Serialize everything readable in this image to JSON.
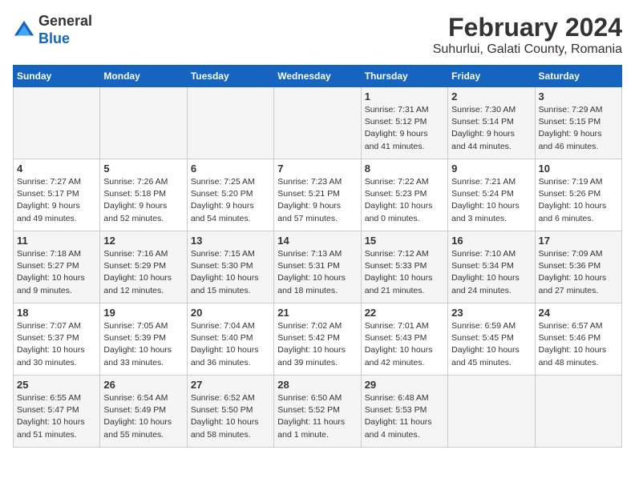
{
  "header": {
    "logo_line1": "General",
    "logo_line2": "Blue",
    "title": "February 2024",
    "subtitle": "Suhurlui, Galati County, Romania"
  },
  "columns": [
    "Sunday",
    "Monday",
    "Tuesday",
    "Wednesday",
    "Thursday",
    "Friday",
    "Saturday"
  ],
  "weeks": [
    [
      {
        "day": "",
        "info": ""
      },
      {
        "day": "",
        "info": ""
      },
      {
        "day": "",
        "info": ""
      },
      {
        "day": "",
        "info": ""
      },
      {
        "day": "1",
        "info": "Sunrise: 7:31 AM\nSunset: 5:12 PM\nDaylight: 9 hours\nand 41 minutes."
      },
      {
        "day": "2",
        "info": "Sunrise: 7:30 AM\nSunset: 5:14 PM\nDaylight: 9 hours\nand 44 minutes."
      },
      {
        "day": "3",
        "info": "Sunrise: 7:29 AM\nSunset: 5:15 PM\nDaylight: 9 hours\nand 46 minutes."
      }
    ],
    [
      {
        "day": "4",
        "info": "Sunrise: 7:27 AM\nSunset: 5:17 PM\nDaylight: 9 hours\nand 49 minutes."
      },
      {
        "day": "5",
        "info": "Sunrise: 7:26 AM\nSunset: 5:18 PM\nDaylight: 9 hours\nand 52 minutes."
      },
      {
        "day": "6",
        "info": "Sunrise: 7:25 AM\nSunset: 5:20 PM\nDaylight: 9 hours\nand 54 minutes."
      },
      {
        "day": "7",
        "info": "Sunrise: 7:23 AM\nSunset: 5:21 PM\nDaylight: 9 hours\nand 57 minutes."
      },
      {
        "day": "8",
        "info": "Sunrise: 7:22 AM\nSunset: 5:23 PM\nDaylight: 10 hours\nand 0 minutes."
      },
      {
        "day": "9",
        "info": "Sunrise: 7:21 AM\nSunset: 5:24 PM\nDaylight: 10 hours\nand 3 minutes."
      },
      {
        "day": "10",
        "info": "Sunrise: 7:19 AM\nSunset: 5:26 PM\nDaylight: 10 hours\nand 6 minutes."
      }
    ],
    [
      {
        "day": "11",
        "info": "Sunrise: 7:18 AM\nSunset: 5:27 PM\nDaylight: 10 hours\nand 9 minutes."
      },
      {
        "day": "12",
        "info": "Sunrise: 7:16 AM\nSunset: 5:29 PM\nDaylight: 10 hours\nand 12 minutes."
      },
      {
        "day": "13",
        "info": "Sunrise: 7:15 AM\nSunset: 5:30 PM\nDaylight: 10 hours\nand 15 minutes."
      },
      {
        "day": "14",
        "info": "Sunrise: 7:13 AM\nSunset: 5:31 PM\nDaylight: 10 hours\nand 18 minutes."
      },
      {
        "day": "15",
        "info": "Sunrise: 7:12 AM\nSunset: 5:33 PM\nDaylight: 10 hours\nand 21 minutes."
      },
      {
        "day": "16",
        "info": "Sunrise: 7:10 AM\nSunset: 5:34 PM\nDaylight: 10 hours\nand 24 minutes."
      },
      {
        "day": "17",
        "info": "Sunrise: 7:09 AM\nSunset: 5:36 PM\nDaylight: 10 hours\nand 27 minutes."
      }
    ],
    [
      {
        "day": "18",
        "info": "Sunrise: 7:07 AM\nSunset: 5:37 PM\nDaylight: 10 hours\nand 30 minutes."
      },
      {
        "day": "19",
        "info": "Sunrise: 7:05 AM\nSunset: 5:39 PM\nDaylight: 10 hours\nand 33 minutes."
      },
      {
        "day": "20",
        "info": "Sunrise: 7:04 AM\nSunset: 5:40 PM\nDaylight: 10 hours\nand 36 minutes."
      },
      {
        "day": "21",
        "info": "Sunrise: 7:02 AM\nSunset: 5:42 PM\nDaylight: 10 hours\nand 39 minutes."
      },
      {
        "day": "22",
        "info": "Sunrise: 7:01 AM\nSunset: 5:43 PM\nDaylight: 10 hours\nand 42 minutes."
      },
      {
        "day": "23",
        "info": "Sunrise: 6:59 AM\nSunset: 5:45 PM\nDaylight: 10 hours\nand 45 minutes."
      },
      {
        "day": "24",
        "info": "Sunrise: 6:57 AM\nSunset: 5:46 PM\nDaylight: 10 hours\nand 48 minutes."
      }
    ],
    [
      {
        "day": "25",
        "info": "Sunrise: 6:55 AM\nSunset: 5:47 PM\nDaylight: 10 hours\nand 51 minutes."
      },
      {
        "day": "26",
        "info": "Sunrise: 6:54 AM\nSunset: 5:49 PM\nDaylight: 10 hours\nand 55 minutes."
      },
      {
        "day": "27",
        "info": "Sunrise: 6:52 AM\nSunset: 5:50 PM\nDaylight: 10 hours\nand 58 minutes."
      },
      {
        "day": "28",
        "info": "Sunrise: 6:50 AM\nSunset: 5:52 PM\nDaylight: 11 hours\nand 1 minute."
      },
      {
        "day": "29",
        "info": "Sunrise: 6:48 AM\nSunset: 5:53 PM\nDaylight: 11 hours\nand 4 minutes."
      },
      {
        "day": "",
        "info": ""
      },
      {
        "day": "",
        "info": ""
      }
    ]
  ]
}
